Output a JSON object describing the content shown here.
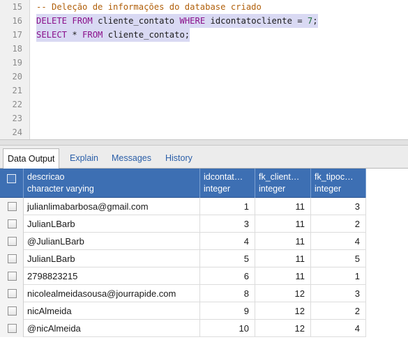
{
  "editor": {
    "lines": [
      {
        "num": "15",
        "parts": [
          {
            "cls": "cmt",
            "text": "-- Deleção de informações do database criado"
          }
        ]
      },
      {
        "num": "16",
        "selected": true,
        "parts": [
          {
            "cls": "kw",
            "text": "DELETE"
          },
          {
            "cls": "op",
            "text": " "
          },
          {
            "cls": "kw",
            "text": "FROM"
          },
          {
            "cls": "op",
            "text": " cliente_contato "
          },
          {
            "cls": "kw",
            "text": "WHERE"
          },
          {
            "cls": "op",
            "text": " idcontatocliente = "
          },
          {
            "cls": "num",
            "text": "7"
          },
          {
            "cls": "op",
            "text": ";"
          }
        ]
      },
      {
        "num": "17",
        "selected": true,
        "parts": [
          {
            "cls": "kw",
            "text": "SELECT"
          },
          {
            "cls": "op",
            "text": " * "
          },
          {
            "cls": "kw",
            "text": "FROM"
          },
          {
            "cls": "op",
            "text": " cliente_contato;"
          }
        ]
      },
      {
        "num": "18",
        "parts": []
      },
      {
        "num": "19",
        "parts": []
      },
      {
        "num": "20",
        "parts": []
      },
      {
        "num": "21",
        "parts": []
      },
      {
        "num": "22",
        "parts": []
      },
      {
        "num": "23",
        "parts": []
      },
      {
        "num": "24",
        "parts": []
      }
    ]
  },
  "tabs": [
    {
      "label": "Data Output",
      "active": true
    },
    {
      "label": "Explain"
    },
    {
      "label": "Messages"
    },
    {
      "label": "History"
    }
  ],
  "grid": {
    "columns": [
      {
        "name": "descricao",
        "type": "character varying"
      },
      {
        "name": "idcontat…",
        "type": "integer"
      },
      {
        "name": "fk_client…",
        "type": "integer"
      },
      {
        "name": "fk_tipoc…",
        "type": "integer"
      }
    ],
    "rows": [
      [
        "julianlimabarbosa@gmail.com",
        "1",
        "11",
        "3"
      ],
      [
        "JulianLBarb",
        "3",
        "11",
        "2"
      ],
      [
        "@JulianLBarb",
        "4",
        "11",
        "4"
      ],
      [
        "JulianLBarb",
        "5",
        "11",
        "5"
      ],
      [
        "2798823215",
        "6",
        "11",
        "1"
      ],
      [
        "nicolealmeidasousa@jourrapide.com",
        "8",
        "12",
        "3"
      ],
      [
        "nicAlmeida",
        "9",
        "12",
        "2"
      ],
      [
        "@nicAlmeida",
        "10",
        "12",
        "4"
      ]
    ]
  },
  "colors": {
    "header_bg": "#3d6fb3",
    "selection": "#d9d9f3",
    "keyword": "#8a0f8a",
    "comment": "#b05f0a",
    "tab_link": "#2a5ea8"
  }
}
